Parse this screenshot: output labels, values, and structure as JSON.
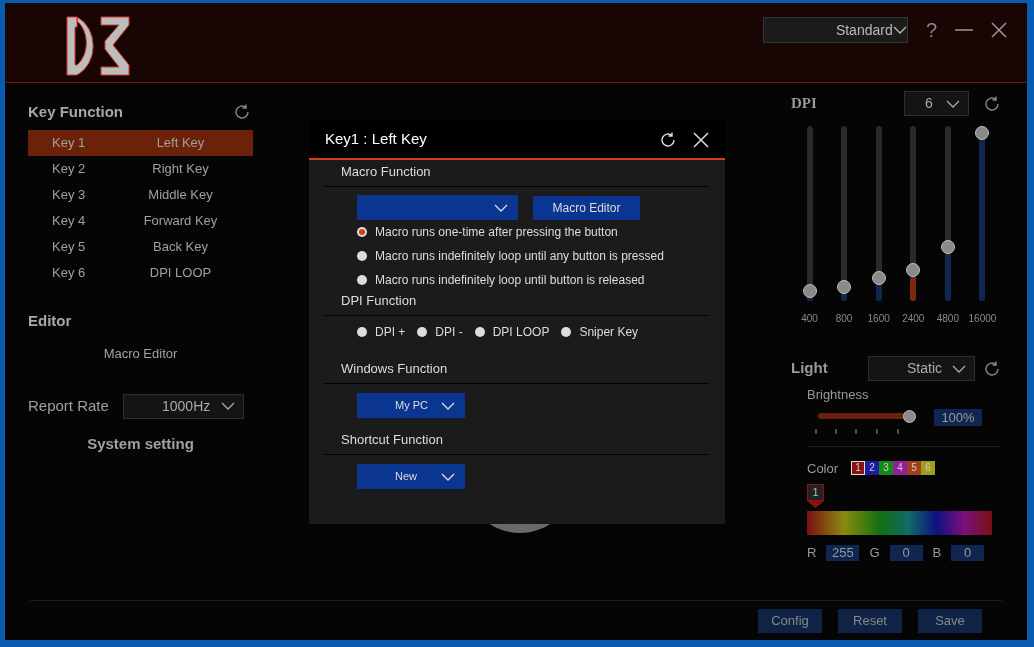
{
  "header": {
    "profile": "Standard",
    "help": "?"
  },
  "key_function": {
    "title": "Key Function",
    "keys": [
      {
        "key": "Key 1",
        "function": "Left Key",
        "selected": true
      },
      {
        "key": "Key 2",
        "function": "Right Key",
        "selected": false
      },
      {
        "key": "Key 3",
        "function": "Middle Key",
        "selected": false
      },
      {
        "key": "Key 4",
        "function": "Forward Key",
        "selected": false
      },
      {
        "key": "Key 5",
        "function": "Back Key",
        "selected": false
      },
      {
        "key": "Key 6",
        "function": "DPI LOOP",
        "selected": false
      }
    ]
  },
  "editor": {
    "title": "Editor",
    "item": "Macro Editor"
  },
  "report_rate": {
    "label": "Report Rate",
    "value": "1000Hz"
  },
  "system_setting": "System setting",
  "dpi": {
    "title": "DPI",
    "count": "6",
    "sliders": [
      {
        "label": "400",
        "level": 0.06,
        "selected": false
      },
      {
        "label": "800",
        "level": 0.08,
        "selected": false
      },
      {
        "label": "1600",
        "level": 0.13,
        "selected": false
      },
      {
        "label": "2400",
        "level": 0.18,
        "selected": true
      },
      {
        "label": "4800",
        "level": 0.31,
        "selected": false
      },
      {
        "label": "16000",
        "level": 0.96,
        "selected": false
      }
    ]
  },
  "light": {
    "title": "Light",
    "mode": "Static",
    "brightness_label": "Brightness",
    "brightness": {
      "level": 0.96,
      "reading": "100%"
    },
    "color_label": "Color",
    "swatches": [
      {
        "label": "1",
        "color": "#8b1212",
        "selected": true
      },
      {
        "label": "2",
        "color": "#1c1ca0",
        "selected": false
      },
      {
        "label": "3",
        "color": "#138a13",
        "selected": false
      },
      {
        "label": "4",
        "color": "#961c9e",
        "selected": false
      },
      {
        "label": "5",
        "color": "#a0401a",
        "selected": false
      },
      {
        "label": "6",
        "color": "#a09c1c",
        "selected": false
      }
    ],
    "marker": "1",
    "rgb": [
      {
        "label": "R",
        "value": "255"
      },
      {
        "label": "G",
        "value": "0"
      },
      {
        "label": "B",
        "value": "0"
      }
    ]
  },
  "footer_buttons": [
    "Config",
    "Reset",
    "Save"
  ],
  "dialog": {
    "title": "Key1 : Left Key",
    "macro": {
      "title": "Macro Function",
      "button": "Macro Editor",
      "options": [
        {
          "label": "Macro runs one-time after pressing the button",
          "selected": true
        },
        {
          "label": "Macro runs indefinitely loop until any button is pressed",
          "selected": false
        },
        {
          "label": "Macro runs indefinitely loop until button is released",
          "selected": false
        }
      ]
    },
    "dpi": {
      "title": "DPI Function",
      "options": [
        {
          "label": "DPI +",
          "selected": false
        },
        {
          "label": "DPI -",
          "selected": false
        },
        {
          "label": "DPI LOOP",
          "selected": false
        },
        {
          "label": "Sniper Key",
          "selected": false
        }
      ]
    },
    "windows": {
      "title": "Windows Function",
      "value": "My PC"
    },
    "shortcut": {
      "title": "Shortcut Function",
      "value": "New"
    }
  }
}
